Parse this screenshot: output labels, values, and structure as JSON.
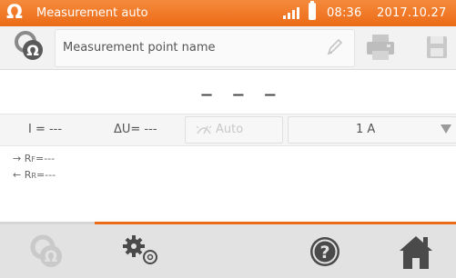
{
  "status_bar": {
    "title": "Measurement auto",
    "time": "08:36",
    "date": "2017.10.27"
  },
  "toolbar": {
    "measurement_point_label": "Measurement point name"
  },
  "display": {
    "result": "– – –"
  },
  "params": {
    "current": "I = ---",
    "voltage_drop": "ΔU= ---",
    "auto_label": "Auto",
    "range_value": "1 A"
  },
  "results": {
    "rf_label": "R",
    "rf_sub": "F",
    "rf_value": "=---",
    "rr_label": "R",
    "rr_sub": "R",
    "rr_value": "=---"
  },
  "colors": {
    "accent": "#ec6b16",
    "bar_bg": "#e2e2e2"
  },
  "icons": [
    "omega-icon",
    "signal-icon",
    "battery-icon",
    "measurement-point-icon",
    "pencil-icon",
    "print-icon",
    "save-icon",
    "auto-icon",
    "dropdown-arrow-icon",
    "measurement-icon",
    "settings-icon",
    "help-icon",
    "home-icon"
  ]
}
